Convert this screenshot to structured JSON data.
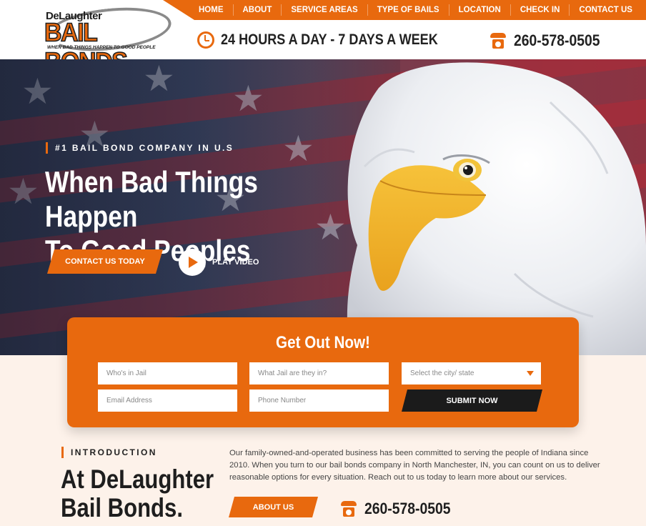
{
  "logo": {
    "top_text": "DeLaughter",
    "main_text": "BAIL BONDS",
    "tagline": "WHEN BAD THINGS HAPPEN TO GOOD PEOPLE"
  },
  "nav": {
    "items": [
      "HOME",
      "ABOUT",
      "SERVICE AREAS",
      "TYPE OF BAILS",
      "LOCATION",
      "CHECK IN",
      "CONTACT US"
    ]
  },
  "header": {
    "hours": "24 HOURS A DAY - 7 DAYS A WEEK",
    "phone": "260-578-0505"
  },
  "hero": {
    "kicker": "#1 BAIL BOND COMPANY IN U.S",
    "title_line1": "When Bad Things Happen",
    "title_line2": "To Good Peoples",
    "cta_label": "CONTACT US TODAY",
    "play_label": "PLAY VIDEO"
  },
  "form": {
    "title": "Get Out Now!",
    "fields": {
      "whos_in_jail": "Who's in Jail",
      "which_jail": "What Jail are they in?",
      "city_state": "Select the city/ state",
      "email": "Email Address",
      "phone": "Phone Number"
    },
    "submit_label": "SUBMIT NOW"
  },
  "intro": {
    "kicker": "INTRODUCTION",
    "title_line1": "At DeLaughter",
    "title_line2": "Bail Bonds.",
    "body": "Our family-owned-and-operated business has been committed to serving the people of Indiana since 2010. When you turn to our bail bonds company in North Manchester, IN, you can count on us to deliver reasonable options for every situation. Reach out to us today to learn more about our services.",
    "about_label": "ABOUT US",
    "phone": "260-578-0505"
  },
  "colors": {
    "accent": "#e8690e",
    "dark": "#1b1b1b",
    "background": "#fdf2ea"
  }
}
